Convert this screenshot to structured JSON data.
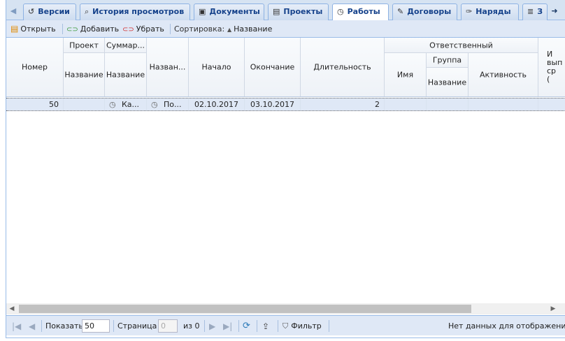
{
  "tabs": [
    {
      "label": "Версии",
      "icon": "version-icon",
      "glyph": "↺"
    },
    {
      "label": "История просмотров",
      "icon": "history-icon",
      "glyph": "🔍"
    },
    {
      "label": "Документы",
      "icon": "documents-icon",
      "glyph": "▣"
    },
    {
      "label": "Проекты",
      "icon": "projects-icon",
      "glyph": "▤"
    },
    {
      "label": "Работы",
      "icon": "works-icon",
      "glyph": "◷",
      "active": true
    },
    {
      "label": "Договоры",
      "icon": "contracts-icon",
      "glyph": "✎"
    },
    {
      "label": "Наряды",
      "icon": "orders-icon",
      "glyph": "✑"
    },
    {
      "label": "З",
      "icon": "tasks-icon",
      "glyph": "≣"
    }
  ],
  "toolbar": {
    "open": "Открыть",
    "add": "Добавить",
    "remove": "Убрать",
    "sort_label": "Сортировка:",
    "sort_field": "Название"
  },
  "columns": {
    "number": "Номер",
    "project_group": "Проект",
    "project_name": "Название",
    "summary_group": "Суммар...",
    "summary_name": "Название",
    "name": "Назван...",
    "start": "Начало",
    "end": "Окончание",
    "duration": "Длительность",
    "responsible_group": "Ответственный",
    "person_name": "Имя",
    "group_group": "Группа",
    "group_name": "Название",
    "activity": "Активность",
    "last_partial": "И\nвып\nср\n("
  },
  "rows": [
    {
      "number": "50",
      "project_name": "",
      "summary_name": "Ка...",
      "name": "По...",
      "start": "02.10.2017",
      "end": "03.10.2017",
      "duration": "2",
      "person_name": "",
      "group_name": "",
      "activity": ""
    }
  ],
  "pager": {
    "show_label": "Показать",
    "page_size": "50",
    "page_label": "Страница",
    "page_value": "0",
    "of_label": "из 0",
    "filter_label": "Фильтр",
    "status": "Нет данных для отображения"
  },
  "colors": {
    "accent": "#15428b",
    "tabstrip": "#d6e3f2",
    "row_selected": "#dfe8f6"
  }
}
